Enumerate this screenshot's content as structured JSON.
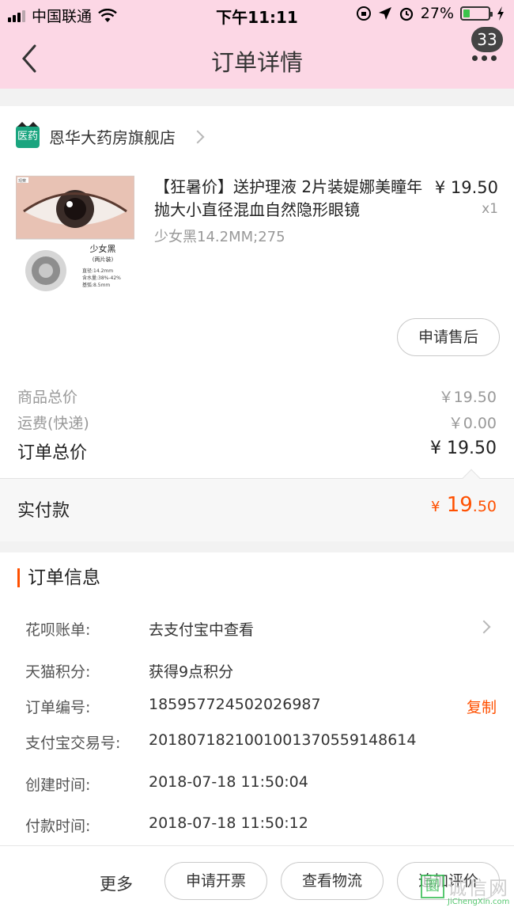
{
  "status_bar": {
    "carrier": "中国联通",
    "time": "下午11:11",
    "battery_percent": "27%",
    "battery_level": 0.27
  },
  "nav": {
    "title": "订单详情",
    "badge_count": "33"
  },
  "store": {
    "icon_label": "医药",
    "name": "恩华大药房旗舰店"
  },
  "product": {
    "title": "【狂暑价】送护理液 2片装媞娜美瞳年抛大小直径混血自然隐形眼镜",
    "price": "¥ 19.50",
    "quantity": "x1",
    "spec": "少女黑14.2MM;275",
    "image_labels": {
      "name": "少女黑",
      "pack": "(两片装)",
      "diameter": "直径:14.2mm",
      "water": "含水量:38%-42%",
      "base_curve": "基弧:8.5mm",
      "tag": "观察"
    },
    "after_sale_button": "申请售后"
  },
  "summary": {
    "goods_label": "商品总价",
    "goods_value": "￥19.50",
    "shipping_label": "运费(快递)",
    "shipping_value": "￥0.00",
    "total_label": "订单总价",
    "total_value": "¥ 19.50"
  },
  "paid": {
    "label": "实付款",
    "currency": "¥",
    "integer": "19",
    "decimal": ".50"
  },
  "order_info": {
    "title": "订单信息",
    "rows": [
      {
        "label": "花呗账单:",
        "value": "去支付宝中查看"
      },
      {
        "label": "天猫积分:",
        "value": "获得9点积分"
      },
      {
        "label": "订单编号:",
        "value": "185957724502026987",
        "action": "复制"
      },
      {
        "label": "支付宝交易号:",
        "value": "2018071821001001370559148614"
      },
      {
        "label": "创建时间:",
        "value": "2018-07-18 11:50:04"
      },
      {
        "label": "付款时间:",
        "value": "2018-07-18 11:50:12"
      }
    ]
  },
  "footer": {
    "more": "更多",
    "invoice_button": "申请开票",
    "logistics_button": "查看物流",
    "review_button": "追加评价"
  },
  "watermark": {
    "box": "圜",
    "text": "诚信网",
    "sub": "JiChengXin.com"
  },
  "colors": {
    "nav_bg": "#fcd7e5",
    "accent": "#ff5000",
    "store_icon": "#1aa57f"
  }
}
